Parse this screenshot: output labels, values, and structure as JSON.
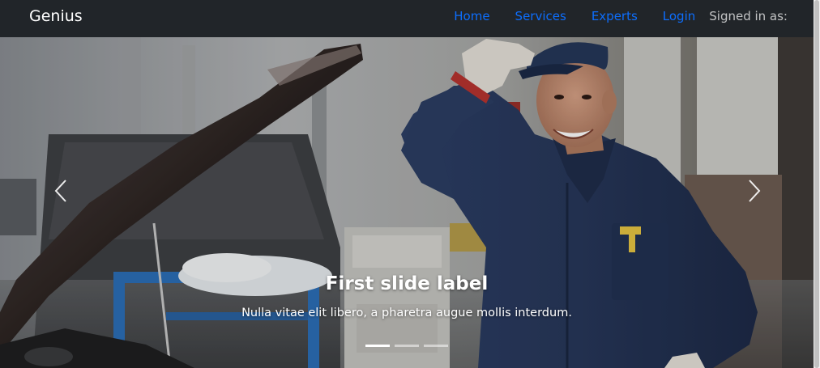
{
  "navbar": {
    "brand": "Genius",
    "links": [
      "Home",
      "Services",
      "Experts",
      "Login"
    ],
    "signed_in_text": "Signed in as:"
  },
  "carousel": {
    "slides_count": 3,
    "active_index": 0,
    "caption": {
      "title": "First slide label",
      "text": "Nulla vitae elit libero, a pharetra augue mollis interdum."
    },
    "controls": {
      "prev_icon": "chevron-left-icon",
      "next_icon": "chevron-right-icon"
    }
  },
  "colors": {
    "navbar_bg": "#212529",
    "link": "#0d6efd",
    "brand": "#ffffff",
    "signed_in": "#bfc0c2",
    "mechanic_jacket": "#2a3b60"
  }
}
